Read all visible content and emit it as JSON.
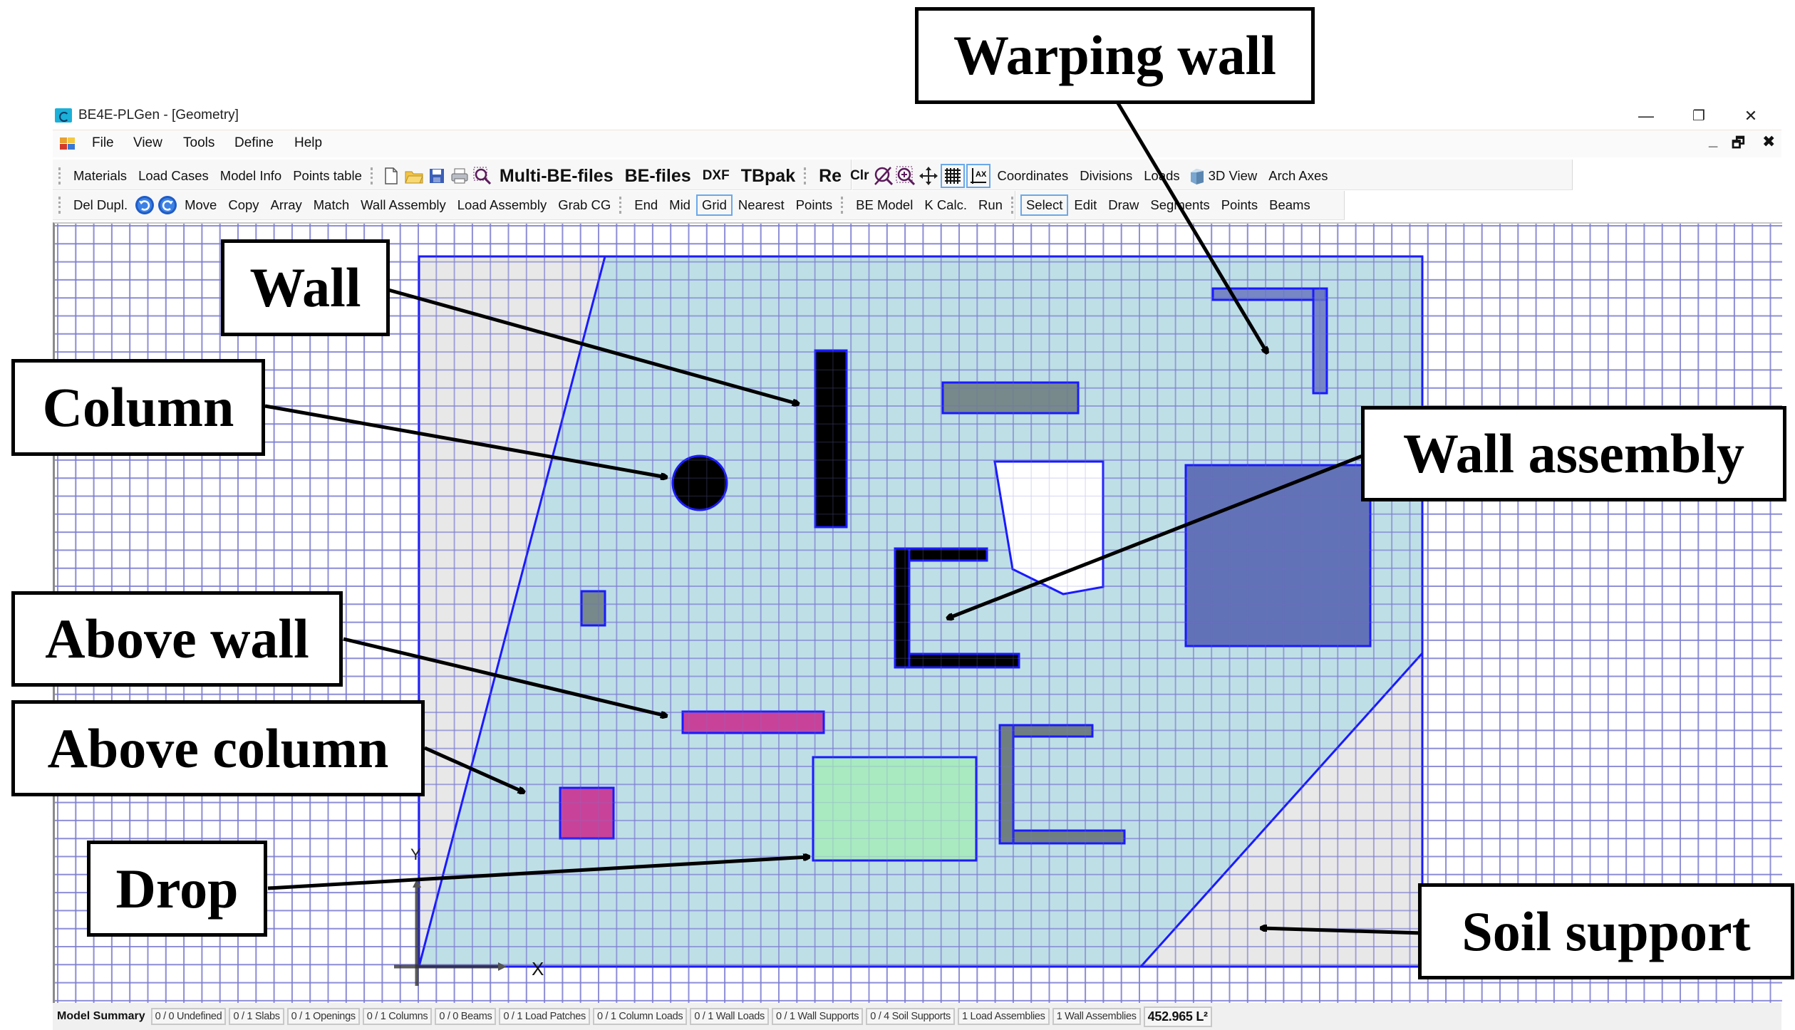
{
  "window": {
    "title": "BE4E-PLGen - [Geometry]",
    "controls": {
      "minimize": "—",
      "restore": "❐",
      "close": "✕"
    },
    "mdi_controls": {
      "minimize": "_",
      "restore": "🗗",
      "close": "✖"
    }
  },
  "menu": {
    "items": [
      "File",
      "View",
      "Tools",
      "Define",
      "Help"
    ]
  },
  "toolbar1": {
    "group1": [
      "Materials",
      "Load Cases",
      "Model Info",
      "Points table"
    ],
    "file_icons": [
      "new-file-icon",
      "open-folder-icon",
      "save-icon",
      "print-icon",
      "zoom-window-icon"
    ],
    "export": [
      "Multi-BE-files",
      "BE-files",
      "DXF",
      "TBpak"
    ],
    "view": {
      "re": "Re",
      "clr": "Clr"
    },
    "view_icons": [
      "zoom-extents-icon",
      "zoom-in-icon",
      "pan-icon",
      "grid-icon",
      "axes-icon"
    ],
    "group3": [
      "Coordinates",
      "Divisions",
      "Loads"
    ],
    "view3d": "3D View",
    "arch_axes": "Arch Axes"
  },
  "toolbar2": {
    "del_dupl": "Del Dupl.",
    "undo_icons": [
      "undo-icon",
      "redo-icon"
    ],
    "edit": [
      "Move",
      "Copy",
      "Array",
      "Match",
      "Wall Assembly",
      "Load Assembly",
      "Grab CG"
    ],
    "snap": [
      "End",
      "Mid",
      "Grid",
      "Nearest",
      "Points"
    ],
    "snap_selected": "Grid",
    "analysis": [
      "BE Model",
      "K Calc.",
      "Run"
    ],
    "mode": [
      "Select",
      "Edit",
      "Draw",
      "Segments",
      "Points",
      "Beams"
    ],
    "mode_selected": "Select"
  },
  "canvas": {
    "axis_labels": {
      "x": "X",
      "y": "Y"
    },
    "colors": {
      "grid": "#7b7bd0",
      "slab_fill": "#bcdde6",
      "slab_edge": "#1a1aff",
      "soil_fill": "#e8e8e8",
      "wall": "#000000",
      "beam_gray": "#6f7f80",
      "opening": "#ffffff",
      "load_patch": "#5d6bb3",
      "warping_wall": "#6a78c0",
      "above": "#c8429a",
      "drop": "#a9eac0"
    }
  },
  "annotations": [
    {
      "id": "warping-wall",
      "label": "Warping wall"
    },
    {
      "id": "wall",
      "label": "Wall"
    },
    {
      "id": "column",
      "label": "Column"
    },
    {
      "id": "wall-assembly",
      "label": "Wall assembly"
    },
    {
      "id": "above-wall",
      "label": "Above wall"
    },
    {
      "id": "above-column",
      "label": "Above column"
    },
    {
      "id": "drop",
      "label": "Drop"
    },
    {
      "id": "soil-support",
      "label": "Soil support"
    }
  ],
  "status": {
    "title": "Model Summary",
    "cells": [
      "0 / 0 Undefined",
      "0 / 1 Slabs",
      "0 / 1 Openings",
      "0 / 1 Columns",
      "0 / 0 Beams",
      "0 / 1 Load Patches",
      "0 / 1 Column Loads",
      "0 / 1 Wall Loads",
      "0 / 1 Wall Supports",
      "0 / 4 Soil Supports",
      "1 Load Assemblies",
      "1 Wall Assemblies"
    ],
    "area": "452.965 L²"
  }
}
